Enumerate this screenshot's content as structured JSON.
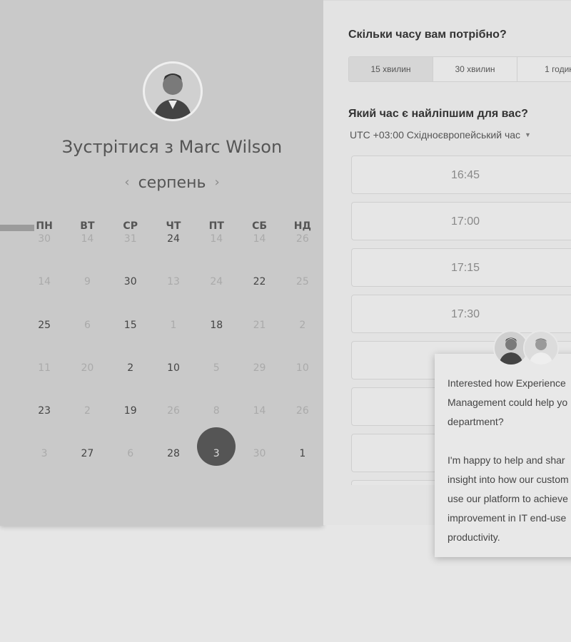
{
  "calendar": {
    "title": "Зустрітися з Marc Wilson",
    "month": "серпень",
    "weekdays": [
      "ПН",
      "ВТ",
      "СР",
      "ЧТ",
      "ПТ",
      "СБ",
      "НД"
    ],
    "weeks": [
      [
        "30",
        "14",
        "31",
        "24",
        "14",
        "14",
        "26"
      ],
      [
        "14",
        "9",
        "30",
        "13",
        "24",
        "22",
        "25"
      ],
      [
        "25",
        "6",
        "15",
        "1",
        "18",
        "21",
        "2"
      ],
      [
        "11",
        "20",
        "2",
        "10",
        "5",
        "29",
        "10"
      ],
      [
        "23",
        "2",
        "19",
        "26",
        "8",
        "14",
        "26"
      ],
      [
        "3",
        "27",
        "6",
        "28",
        "3",
        "30",
        "1"
      ]
    ]
  },
  "duration": {
    "question": "Скільки часу вам потрібно?",
    "options": [
      "15 хвилин",
      "30 хвилин",
      "1 годин"
    ]
  },
  "time": {
    "question": "Який час є найліпшим для вас?",
    "timezone": "UTC +03:00 Східноєвропейський час",
    "slots": [
      "16:45",
      "17:00",
      "17:15",
      "17:30",
      "",
      "",
      "",
      ""
    ]
  },
  "chat": {
    "message": "Interested how Experience\nManagement could help yo\ndepartment?\n\nI'm happy to help and shar\ninsight into how our custom\nuse our platform to achieve\nimprovement in IT end-use\nproductivity."
  }
}
